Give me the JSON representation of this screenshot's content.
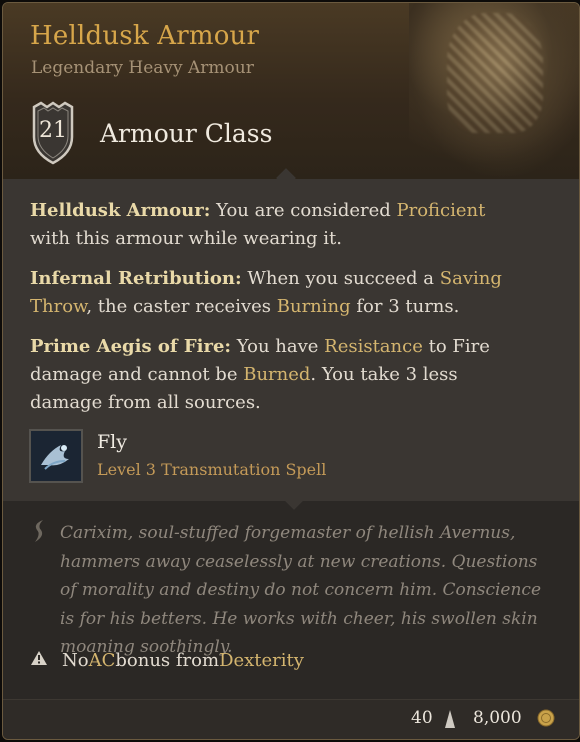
{
  "item": {
    "name": "Helldusk Armour",
    "subtitle": "Legendary Heavy Armour",
    "armour_class_value": "21",
    "armour_class_label": "Armour Class"
  },
  "properties": [
    {
      "name": "Helldusk Armour:",
      "t1": " You are considered ",
      "k1": "Proficient",
      "t2": " with this armour while wearing it."
    },
    {
      "name": "Infernal Retribution:",
      "t1": " When you succeed a ",
      "k1": "Saving Throw",
      "t2": ", the caster receives ",
      "k2": "Burning",
      "t3": " for 3 turns."
    },
    {
      "name": "Prime Aegis of Fire:",
      "t1": " You have ",
      "k1": "Resistance",
      "t2": " to Fire damage and cannot be ",
      "k2": "Burned",
      "t3": ". You take 3 less damage from all sources."
    }
  ],
  "spell": {
    "name": "Fly",
    "subtitle": "Level 3 Transmutation Spell",
    "icon": "winged-fly-icon"
  },
  "lore": "Carixim, soul-stuffed forgemaster of hellish Avernus, hammers away ceaselessly at new creations. Questions of morality and destiny do not concern him. Conscience is for his betters. He works with cheer, his swollen skin moaning soothingly.",
  "warning": {
    "t1": "No ",
    "k1": "AC",
    "t2": " bonus from ",
    "k2": "Dexterity"
  },
  "footer": {
    "weight": "40",
    "price": "8,000"
  },
  "colors": {
    "title": "#d7a64a",
    "keyword": "#d4b56f",
    "panel": "#3a3632",
    "header": "#3d3020"
  }
}
